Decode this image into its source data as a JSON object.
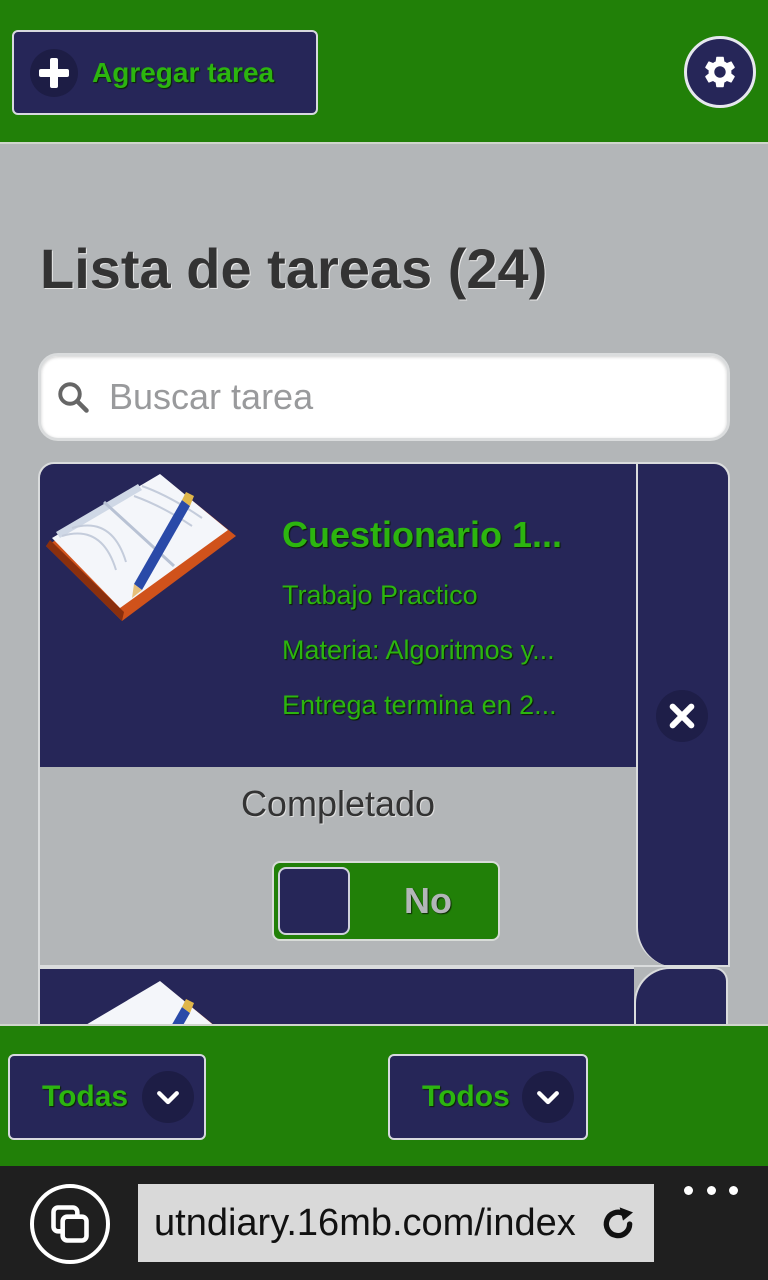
{
  "header": {
    "add_task_label": "Agregar tarea",
    "add_icon": "plus-icon",
    "settings_icon": "gear-icon"
  },
  "page": {
    "title": "Lista de tareas (24)"
  },
  "search": {
    "placeholder": "Buscar tarea",
    "value": ""
  },
  "tasks": [
    {
      "title": "Cuestionario 1...",
      "type": "Trabajo Practico",
      "subject": "Materia: Algoritmos y...",
      "deadline": "Entrega termina en 2...",
      "completed_label": "Completado",
      "completed_toggle": "No",
      "icon": "book-icon",
      "delete_icon": "close-icon"
    }
  ],
  "footer": {
    "filter_status": "Todas",
    "filter_subject": "Todos"
  },
  "browser": {
    "url": "utndiary.16mb.com/index",
    "tabs_icon": "tabs-icon",
    "refresh_icon": "refresh-icon",
    "more_icon": "more-icon"
  },
  "colors": {
    "primary_green": "#218008",
    "accent_green_text": "#2cb50f",
    "navy": "#262658",
    "page_background": "#b3b6b8"
  }
}
